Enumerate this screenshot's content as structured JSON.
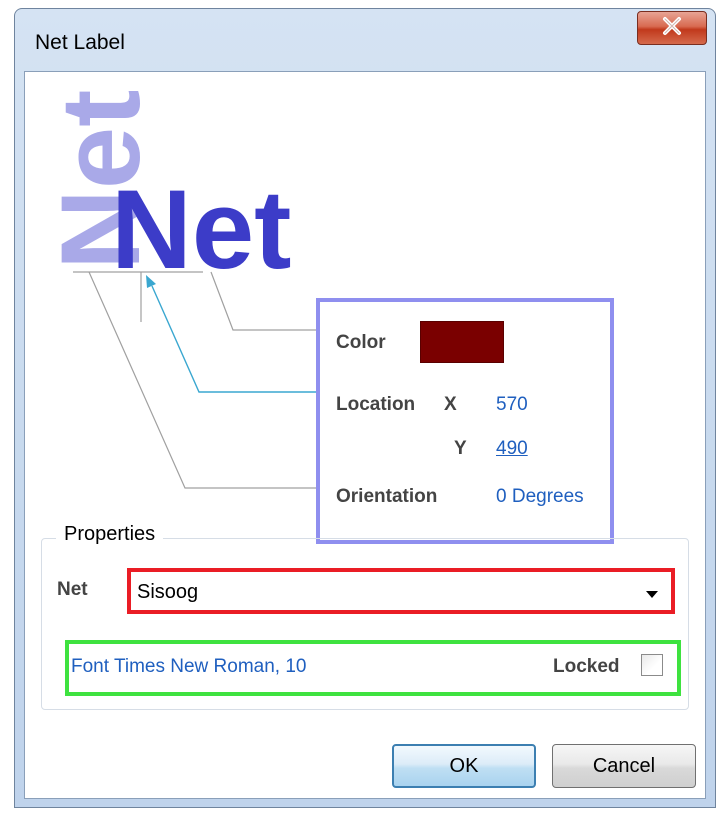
{
  "window": {
    "title": "Net Label",
    "close_icon": "close-x-icon"
  },
  "illustration": {
    "label_text_vertical": "Net",
    "label_text_horizontal": "Net",
    "colors": {
      "vertical_label": "#a9a9e8",
      "horizontal_label": "#3c3cc8",
      "callout_box": "#8f8fef",
      "leader_line": "#a0a0a0",
      "arrow": "#3aa7d0"
    }
  },
  "properties_preview": {
    "color_label": "Color",
    "color_value": "#7a0000",
    "location_label": "Location",
    "x_label": "X",
    "x_value": "570",
    "y_label": "Y",
    "y_value": "490",
    "orientation_label": "Orientation",
    "orientation_value": "0 Degrees"
  },
  "properties": {
    "group_title": "Properties",
    "net_label": "Net",
    "net_value": "Sisoog",
    "font_label": "Font",
    "font_value": "Times New Roman, 10",
    "locked_label": "Locked",
    "locked_checked": false
  },
  "buttons": {
    "ok": "OK",
    "cancel": "Cancel"
  }
}
